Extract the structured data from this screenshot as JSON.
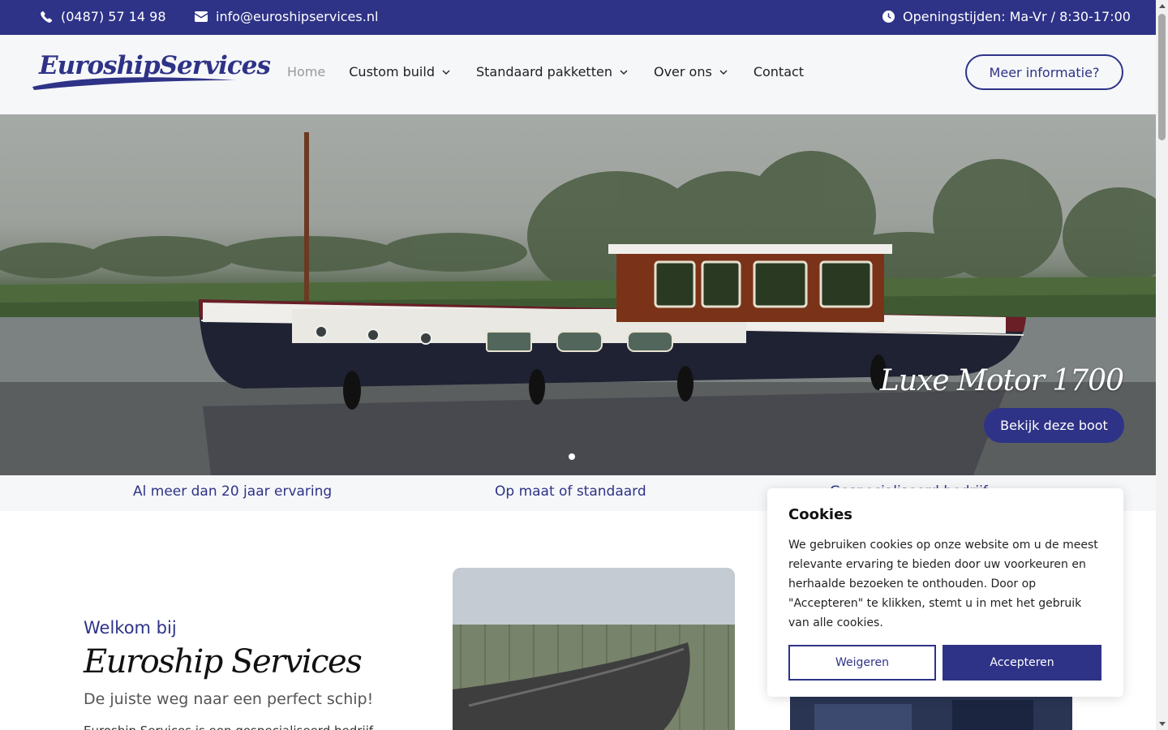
{
  "topbar": {
    "phone": "(0487) 57 14 98",
    "email": "info@euroshipservices.nl",
    "hours": "Openingstijden: Ma-Vr / 8:30-17:00",
    "phone_icon": "phone-icon",
    "email_icon": "envelope-icon",
    "hours_icon": "clock-icon",
    "background": "#2e3387"
  },
  "header": {
    "logo_text": "EuroshipServices",
    "nav": [
      {
        "label": "Home",
        "active": true
      },
      {
        "label": "Custom build",
        "has_dropdown": true
      },
      {
        "label": "Standaard pakketten",
        "has_dropdown": true
      },
      {
        "label": "Over ons",
        "has_dropdown": true
      },
      {
        "label": "Contact"
      }
    ],
    "cta_label": " Meer informatie?"
  },
  "hero": {
    "title": "Luxe Motor 1700",
    "button": "Bekijk deze boot",
    "slides": 1
  },
  "features": [
    {
      "label": " Al meer dan 20 jaar ervaring"
    },
    {
      "label": " Op maat of standaard"
    },
    {
      "label": " Gespecialiseerd bedrijf"
    }
  ],
  "welcome": {
    "subtitle": "Welkom bij",
    "title": "Euroship Services",
    "tagline": "De juiste weg naar een perfect schip!",
    "body": "Euroship Services is een gespecialiseerd bedrijf"
  },
  "cookie": {
    "title": "Cookies",
    "text": "We gebruiken cookies op onze website om u de meest relevante ervaring te bieden door uw voorkeuren en herhaalde bezoeken te onthouden. Door op \"Accepteren\" te klikken, stemt u in met het gebruik van alle cookies.",
    "reject": "Weigeren",
    "accept": "Accepteren"
  },
  "colors": {
    "brand": "#2e3387",
    "light_bg": "#f6f7f9"
  }
}
